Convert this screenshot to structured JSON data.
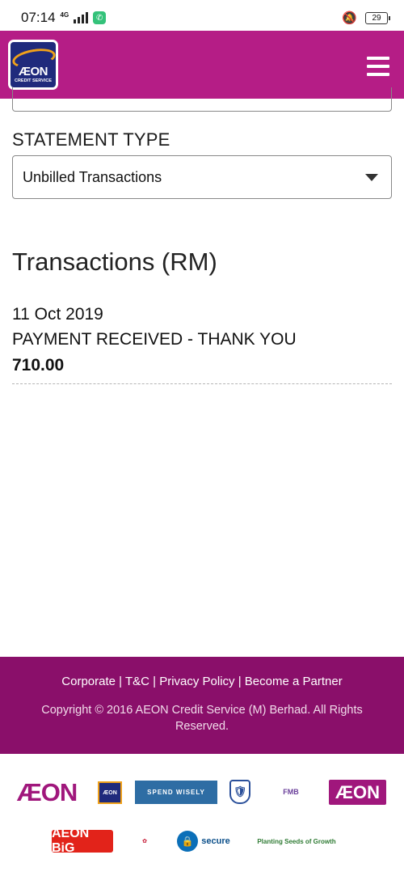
{
  "status_bar": {
    "time": "07:14",
    "network": "4G",
    "battery": "29",
    "icons": [
      "signal-icon",
      "app-notification-icon",
      "notifications-off-icon",
      "battery-icon"
    ]
  },
  "header": {
    "logo_text": "ÆON",
    "logo_subtext": "CREDIT SERVICE",
    "menu_icon": "hamburger-menu-icon",
    "brand_color": "#b51d86"
  },
  "form": {
    "statement_type_label": "STATEMENT TYPE",
    "statement_type_value": "Unbilled Transactions",
    "dropdown_icon": "caret-down-icon"
  },
  "transactions": {
    "title": "Transactions (RM)",
    "items": [
      {
        "date": "11 Oct 2019",
        "description": "PAYMENT RECEIVED - THANK YOU",
        "amount": "710.00"
      }
    ]
  },
  "footer": {
    "links": [
      "Corporate",
      "T&C",
      "Privacy Policy",
      "Become a Partner"
    ],
    "separator": " | ",
    "copyright": "Copyright © 2016 AEON Credit Service (M) Berhad. All Rights Reserved.",
    "background_color": "#8a0f6a"
  },
  "partners": {
    "aeon_logo": "ÆON",
    "aeon_credit_logo": "ÆON",
    "spend_wisely": "SPEND WISELY",
    "fmb": "FMB",
    "aeon_logo_2": "ÆON",
    "big": "AEON BiG",
    "secure": "secure",
    "planting": "Planting Seeds of Growth"
  }
}
